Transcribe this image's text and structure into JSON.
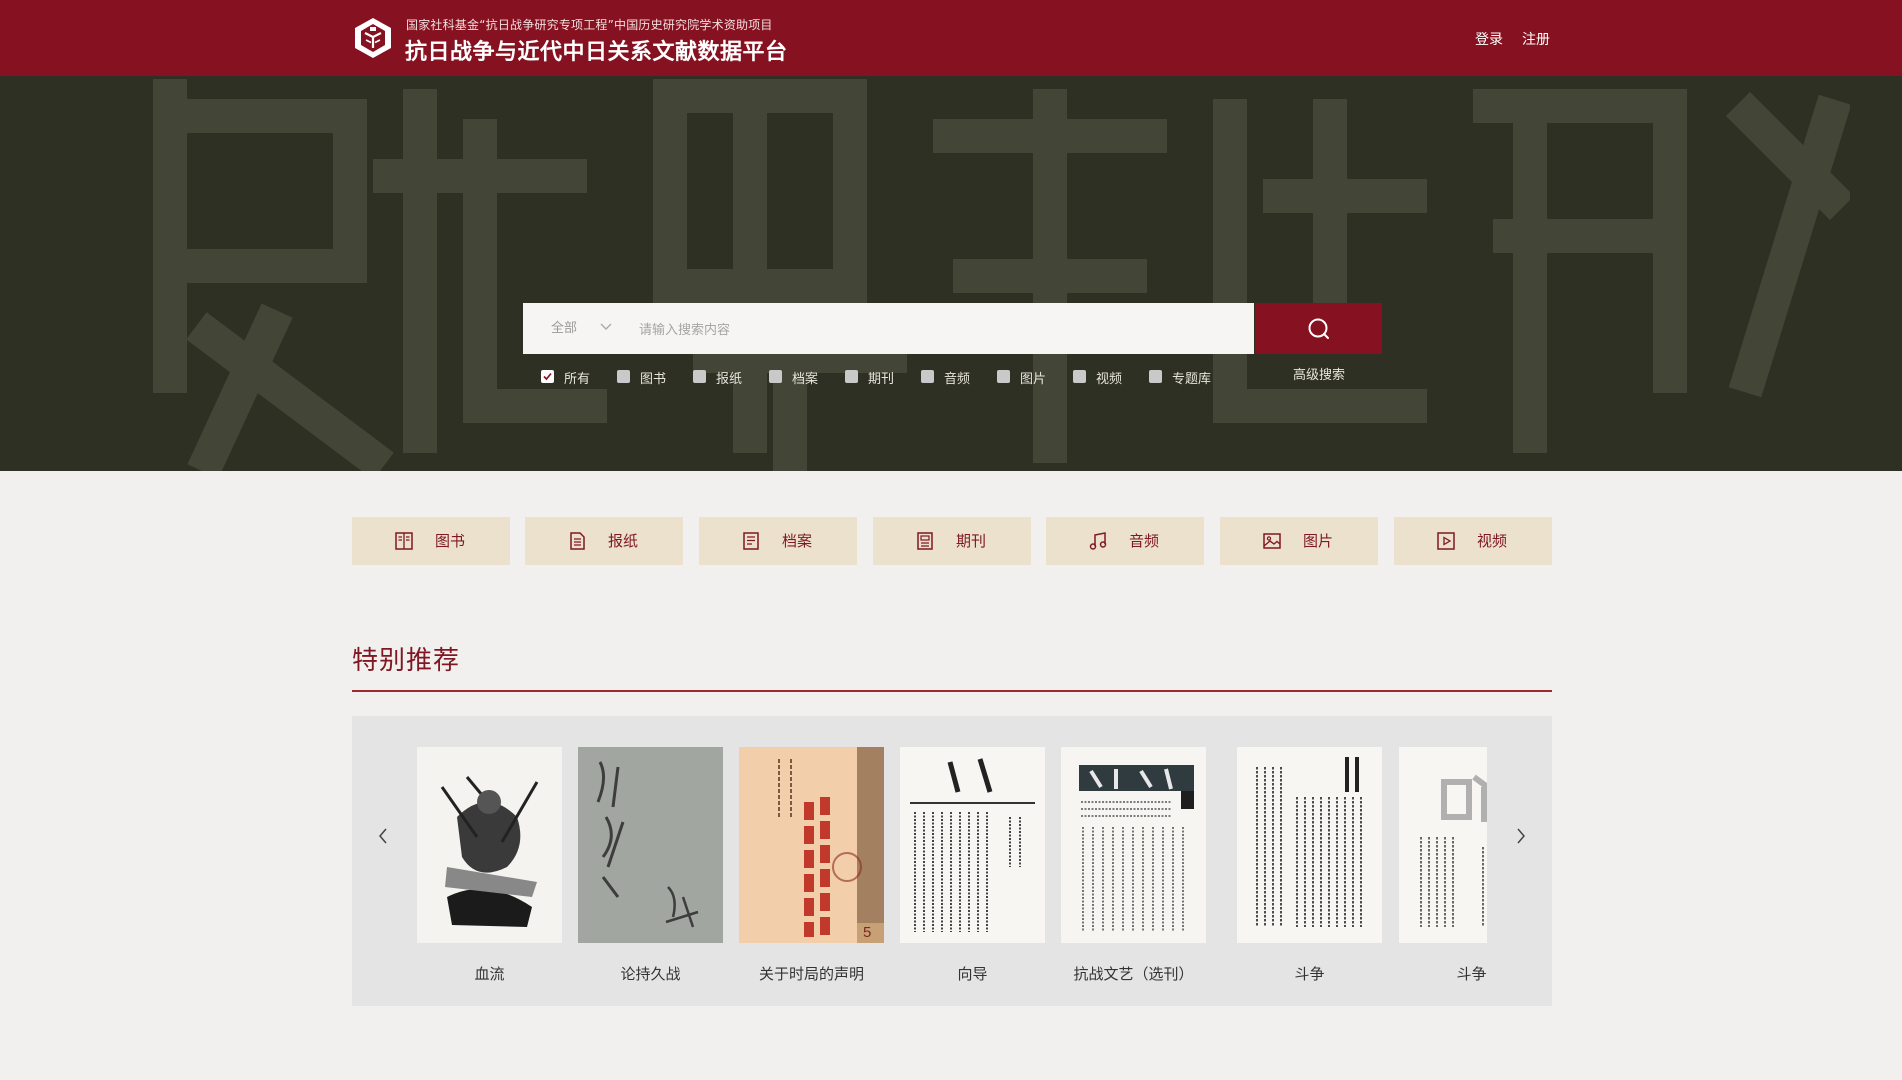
{
  "header": {
    "subtitle": "国家社科基金“抗日战争研究专项工程”中国历史研究院学术资助项目",
    "title": "抗日战争与近代中日关系文献数据平台",
    "login": "登录",
    "register": "注册"
  },
  "search": {
    "scope": "全部",
    "placeholder": "请输入搜索内容",
    "advanced": "高级搜索",
    "filters": [
      {
        "label": "所有",
        "checked": true
      },
      {
        "label": "图书",
        "checked": false
      },
      {
        "label": "报纸",
        "checked": false
      },
      {
        "label": "档案",
        "checked": false
      },
      {
        "label": "期刊",
        "checked": false
      },
      {
        "label": "音频",
        "checked": false
      },
      {
        "label": "图片",
        "checked": false
      },
      {
        "label": "视频",
        "checked": false
      },
      {
        "label": "专题库",
        "checked": false
      }
    ]
  },
  "categories": [
    {
      "label": "图书",
      "icon": "book-icon"
    },
    {
      "label": "报纸",
      "icon": "newspaper-icon"
    },
    {
      "label": "档案",
      "icon": "archive-icon"
    },
    {
      "label": "期刊",
      "icon": "journal-icon"
    },
    {
      "label": "音频",
      "icon": "music-icon"
    },
    {
      "label": "图片",
      "icon": "image-icon"
    },
    {
      "label": "视频",
      "icon": "video-icon"
    }
  ],
  "featured": {
    "title": "特别推荐",
    "items": [
      {
        "label": "血流"
      },
      {
        "label": "论持久战"
      },
      {
        "label": "关于时局的声明"
      },
      {
        "label": "向导"
      },
      {
        "label": "抗战文艺（选刊）"
      },
      {
        "label": "斗争"
      },
      {
        "label": "斗争"
      }
    ]
  },
  "colors": {
    "brand": "#861120",
    "hero": "#2e3023",
    "category_bg": "#ece1cd"
  }
}
